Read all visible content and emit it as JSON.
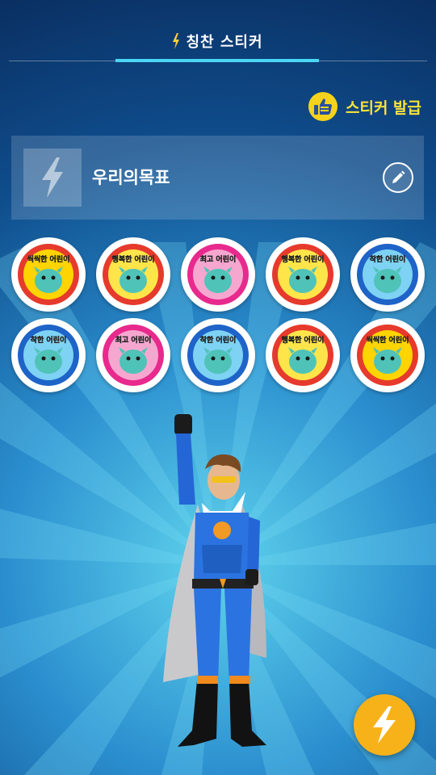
{
  "header": {
    "title": "칭찬 스티커",
    "active_tab": "칭찬 스티커"
  },
  "issue": {
    "label": "스티커 발급",
    "icon": "thumbs-up-icon"
  },
  "goal": {
    "title": "우리의목표",
    "thumb_icon": "lightning-icon",
    "edit_icon": "pencil-icon"
  },
  "stickers": [
    {
      "caption": "씩씩한 어린이",
      "ring": "#e63a2c",
      "inner": "#ffd400",
      "monster": "#4fc3b8"
    },
    {
      "caption": "행복한 어린이",
      "ring": "#e63a2c",
      "inner": "#ffe54a",
      "monster": "#4fc3b8"
    },
    {
      "caption": "최고 어린이",
      "ring": "#e8298d",
      "inner": "#f6a7cf",
      "monster": "#4fc3b8"
    },
    {
      "caption": "행복한 어린이",
      "ring": "#e63a2c",
      "inner": "#ffe54a",
      "monster": "#4fc3b8"
    },
    {
      "caption": "착한 어린이",
      "ring": "#1e63c8",
      "inner": "#7ed2f3",
      "monster": "#4fc3b8"
    },
    {
      "caption": "착한 어린이",
      "ring": "#1e63c8",
      "inner": "#7ed2f3",
      "monster": "#4fc3b8"
    },
    {
      "caption": "최고 어린이",
      "ring": "#e8298d",
      "inner": "#f6a7cf",
      "monster": "#4fc3b8"
    },
    {
      "caption": "착한 어린이",
      "ring": "#1e63c8",
      "inner": "#7ed2f3",
      "monster": "#4fc3b8"
    },
    {
      "caption": "행복한 어린이",
      "ring": "#e63a2c",
      "inner": "#ffe54a",
      "monster": "#4fc3b8"
    },
    {
      "caption": "씩씩한 어린이",
      "ring": "#e63a2c",
      "inner": "#ffd400",
      "monster": "#4fc3b8"
    }
  ],
  "fab": {
    "icon": "lightning-icon"
  },
  "colors": {
    "accent": "#4ad6f4",
    "yellow": "#ffe33a",
    "fab": "#f7b21a"
  }
}
